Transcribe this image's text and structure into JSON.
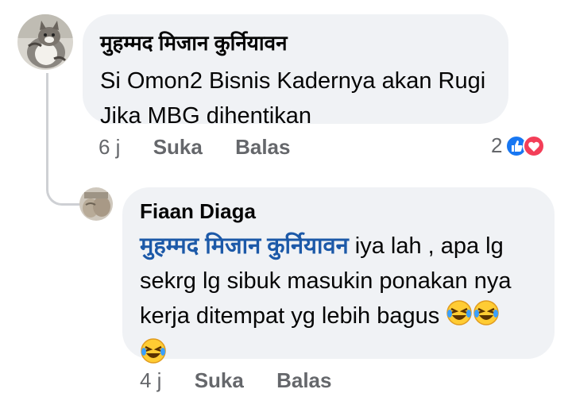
{
  "comment1": {
    "author": "मुहम्मद मिजान कुर्नियावन",
    "text_line1": "Si Omon2 Bisnis Kadernya akan Rugi",
    "text_line2": "Jika MBG dihentikan",
    "time": "6 j",
    "like_label": "Suka",
    "reply_label": "Balas",
    "reaction_count": "2",
    "reaction_icons": [
      "like-icon",
      "love-icon"
    ]
  },
  "reply1": {
    "author": "Fiaan Diaga",
    "mention": "मुहम्मद मिजान कुर्नियावन",
    "text_line1": " iya lah , apa lg",
    "text_line2": "sekrg lg sibuk masukin ponakan nya",
    "text_line3": "kerja ditempat yg lebih bagus ",
    "emoji": "rolling-on-floor-laughing-emoji",
    "time": "4 j",
    "like_label": "Suka",
    "reply_label": "Balas"
  },
  "colors": {
    "bubble": "#f0f2f5",
    "mention": "#1c59a8",
    "meta": "#65676b",
    "like": "#1877f2",
    "love": "#f33e58"
  }
}
